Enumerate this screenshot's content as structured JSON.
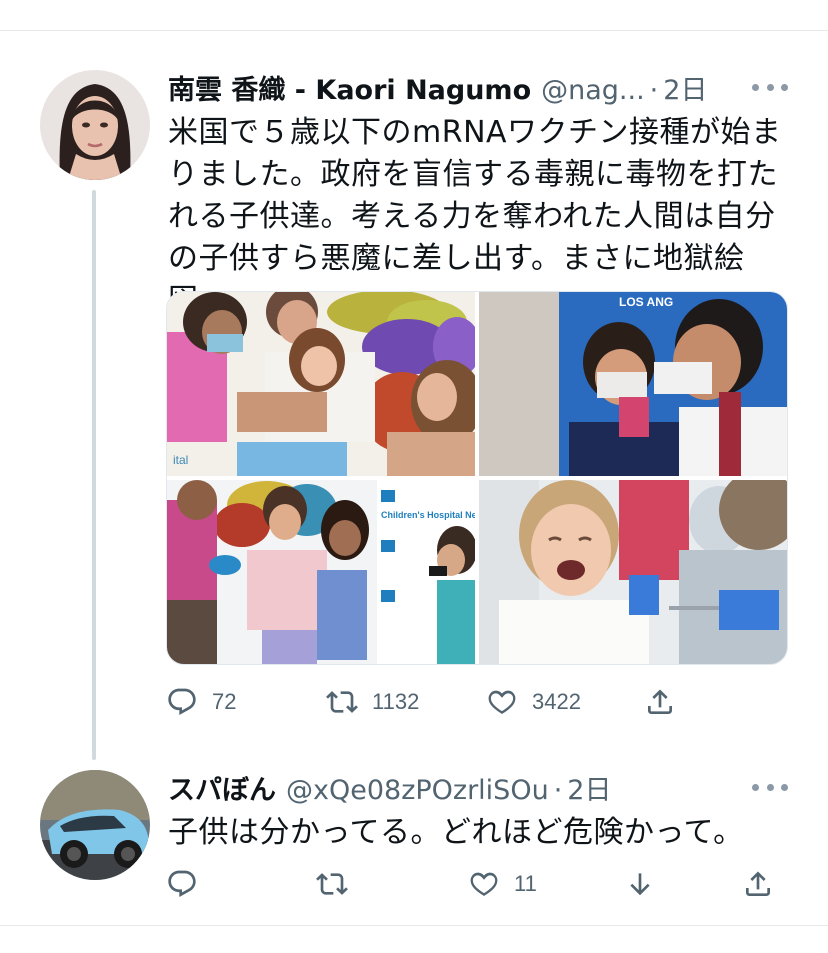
{
  "tweet": {
    "name": "南雲 香織 - Kaori Nagumo",
    "handle": "@nag...",
    "separator": "·",
    "time": "2日",
    "text": "米国で５歳以下のmRNAワクチン接種が始まりました。政府を盲信する毒親に毒物を打たれる子供達。考える力を奪われた人間は自分の子供すら悪魔に差し出す。まさに地獄絵図。",
    "media": [
      {
        "icon": "photo-vaccination-girl"
      },
      {
        "icon": "photo-boy-doctor",
        "sign_text": "LOS ANG"
      },
      {
        "icon": "photo-childrens-hospital",
        "sign_text": "Children's Hospital New Orleans"
      },
      {
        "icon": "photo-crying-girl"
      }
    ],
    "actions": {
      "reply_count": "72",
      "retweet_count": "1132",
      "like_count": "3422"
    }
  },
  "reply": {
    "name": "スパぼん",
    "handle": "@xQe08zPOzrliSOu",
    "separator": "·",
    "time": "2日",
    "text": "子供は分かってる。どれほど危険かって。",
    "actions": {
      "reply_count": "",
      "retweet_count": "",
      "like_count": "11"
    }
  },
  "colors": {
    "text": "#0f1419",
    "secondary": "#536471",
    "thread_line": "#cfd9de",
    "divider": "#e6e9ec"
  }
}
